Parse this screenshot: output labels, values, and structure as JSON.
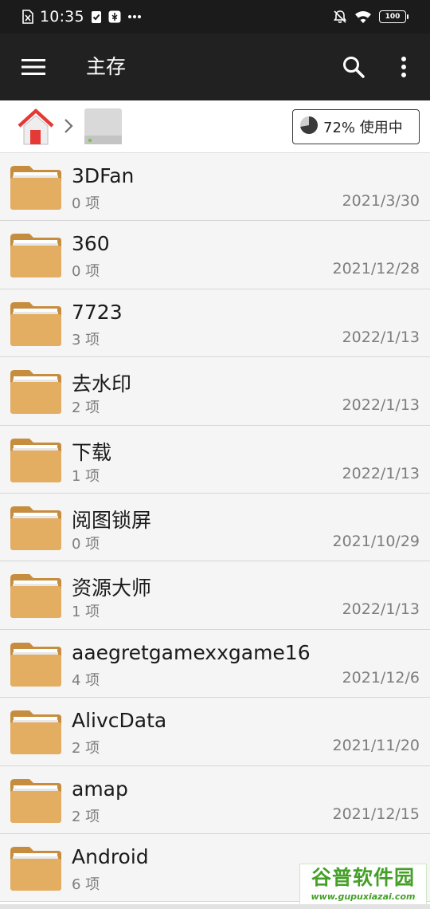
{
  "status_bar": {
    "time": "10:35",
    "battery": "100",
    "left_icons": [
      "sim-card-icon",
      "check-badge-icon",
      "usb-icon",
      "more-dots-icon"
    ],
    "right_icons": [
      "bell-off-icon",
      "wifi-icon",
      "battery-icon"
    ]
  },
  "app_bar": {
    "title": "主存",
    "icons": [
      "menu-icon",
      "search-icon",
      "more-vertical-icon"
    ]
  },
  "breadcrumb": {
    "items": [
      "home-icon",
      "drive-icon"
    ],
    "storage_label": "72% 使用中",
    "storage_used_fraction": 0.72
  },
  "files": [
    {
      "name": "3DFan",
      "count": "0 项",
      "date": "2021/3/30"
    },
    {
      "name": "360",
      "count": "0 项",
      "date": "2021/12/28"
    },
    {
      "name": "7723",
      "count": "3 项",
      "date": "2022/1/13"
    },
    {
      "name": "去水印",
      "count": "2 项",
      "date": "2022/1/13"
    },
    {
      "name": "下载",
      "count": "1 项",
      "date": "2022/1/13"
    },
    {
      "name": "阅图锁屏",
      "count": "0 项",
      "date": "2021/10/29"
    },
    {
      "name": "资源大师",
      "count": "1 项",
      "date": "2022/1/13"
    },
    {
      "name": "aaegretgamexxgame16",
      "count": "4 项",
      "date": "2021/12/6"
    },
    {
      "name": "AlivcData",
      "count": "2 项",
      "date": "2021/11/20"
    },
    {
      "name": "amap",
      "count": "2 项",
      "date": "2021/12/15"
    },
    {
      "name": "Android",
      "count": "6 项",
      "date": ""
    }
  ],
  "watermark": {
    "title": "谷普软件园",
    "url": "www.gupuxiazai.com"
  },
  "colors": {
    "status_bar_bg": "#1b1b1b",
    "app_bar_bg": "#212121",
    "list_bg": "#f5f5f5",
    "folder_fill": "#e3ad62",
    "folder_back": "#c78d3e",
    "watermark_green": "#45a028"
  }
}
